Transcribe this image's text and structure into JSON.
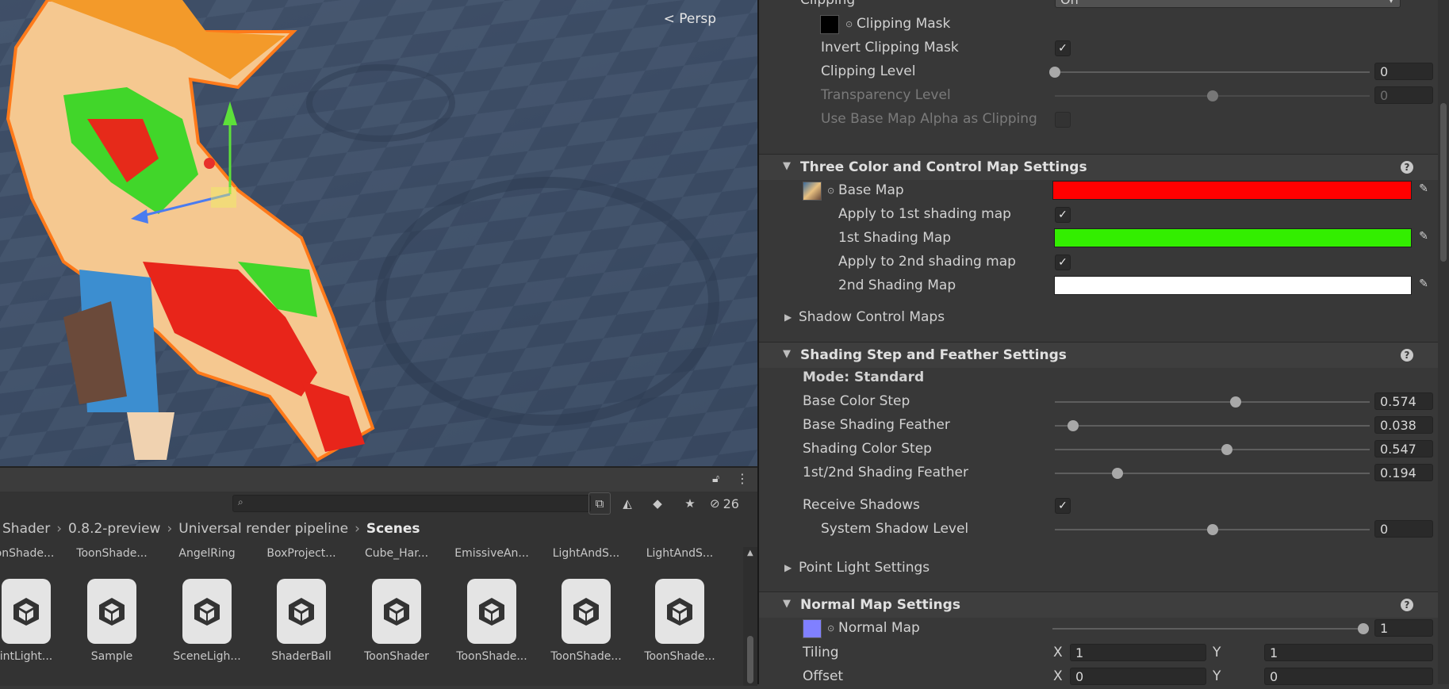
{
  "scene": {
    "view_label": "Persp"
  },
  "project": {
    "hidden_count": "26",
    "breadcrumb": [
      "Shader",
      "0.8.2-preview",
      "Universal render pipeline",
      "Scenes"
    ],
    "top_row": [
      "onShade...",
      "ToonShade...",
      "AngelRing",
      "BoxProject...",
      "Cube_Har...",
      "EmissiveAn...",
      "LightAndS...",
      "LightAndS..."
    ],
    "assets": [
      "intLight...",
      "Sample",
      "SceneLigh...",
      "ShaderBall",
      "ToonShader",
      "ToonShade...",
      "ToonShade...",
      "ToonShade..."
    ]
  },
  "inspector": {
    "clipping_partial": "Clipping",
    "clipping_value": "On",
    "clipping_mask": "Clipping Mask",
    "invert_clipping_mask": "Invert Clipping Mask",
    "clipping_level": {
      "label": "Clipping Level",
      "value": "0",
      "fraction": 0.0
    },
    "transparency_level": {
      "label": "Transparency Level",
      "value": "0",
      "fraction": 0.5
    },
    "use_base_map_alpha": "Use Base Map Alpha as Clipping",
    "three_color": {
      "title": "Three Color and Control Map Settings",
      "base_map": "Base Map",
      "base_color": "#ff0000",
      "apply_1st": "Apply to 1st shading map",
      "first_shading": "1st Shading Map",
      "first_color": "#33ee00",
      "apply_2nd": "Apply to 2nd shading map",
      "second_shading": "2nd Shading Map",
      "second_color": "#ffffff"
    },
    "shadow_control_maps": "Shadow Control Maps",
    "shading_step": {
      "title": "Shading Step and Feather Settings",
      "mode": "Mode: Standard",
      "base_color_step": {
        "label": "Base Color Step",
        "value": "0.574",
        "fraction": 0.574
      },
      "base_shading_feather": {
        "label": "Base Shading Feather",
        "value": "0.038",
        "fraction": 0.058
      },
      "shading_color_step": {
        "label": "Shading Color Step",
        "value": "0.547",
        "fraction": 0.547
      },
      "shading_feather": {
        "label": "1st/2nd Shading Feather",
        "value": "0.194",
        "fraction": 0.2
      },
      "receive_shadows": "Receive Shadows",
      "system_shadow_level": {
        "label": "System Shadow Level",
        "value": "0",
        "fraction": 0.5
      }
    },
    "point_light_settings": "Point Light Settings",
    "normal_map": {
      "title": "Normal Map Settings",
      "label": "Normal Map",
      "value": "1",
      "fraction": 1.0,
      "tiling_label": "Tiling",
      "tiling_x": "1",
      "tiling_y": "1",
      "offset_label": "Offset",
      "offset_x": "0",
      "offset_y": "0",
      "x": "X",
      "y": "Y"
    }
  }
}
